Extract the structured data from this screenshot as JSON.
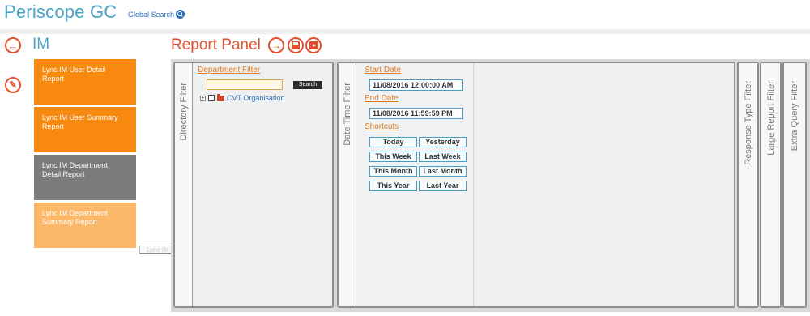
{
  "app": {
    "title": "Periscope GC",
    "global_search": "Global Search"
  },
  "section": {
    "title": "IM"
  },
  "reports": [
    {
      "label": "Lync IM User Detail Report",
      "color": "#f7890f"
    },
    {
      "label": "Lync IM User Summary Report",
      "color": "#f7890f"
    },
    {
      "label": "Lync IM Department Detail Report",
      "color": "#7b7b7b"
    },
    {
      "label": "Lync IM Department Summary Report",
      "color": "#fbb868"
    }
  ],
  "drag_ghost": {
    "label": "Lync IM Department Summary Report"
  },
  "report_panel": {
    "title": "Report Panel",
    "directory_filter": {
      "tab_label": "Directory Filter",
      "department_filter_label": "Department Filter",
      "search_input_value": "",
      "search_button": "Search",
      "tree": [
        {
          "label": "CVT Organisation",
          "expand": "+"
        }
      ]
    },
    "date_time_filter": {
      "tab_label": "Date Time Filter",
      "start_date_label": "Start Date",
      "start_date_value": "11/08/2016 12:00:00 AM",
      "end_date_label": "End Date",
      "end_date_value": "11/08/2016 11:59:59 PM",
      "shortcuts_label": "Shortcuts",
      "shortcuts": [
        "Today",
        "Yesterday",
        "This Week",
        "Last Week",
        "This Month",
        "Last Month",
        "This Year",
        "Last Year"
      ]
    },
    "collapsed_filters": {
      "response_type": "Response Type Filter",
      "large_report": "Large Report Filter",
      "extra_query": "Extra Query Filter"
    }
  },
  "colors": {
    "brand_blue": "#4aa3c8",
    "accent_red": "#e2502e",
    "link_orange": "#e37b1e"
  }
}
